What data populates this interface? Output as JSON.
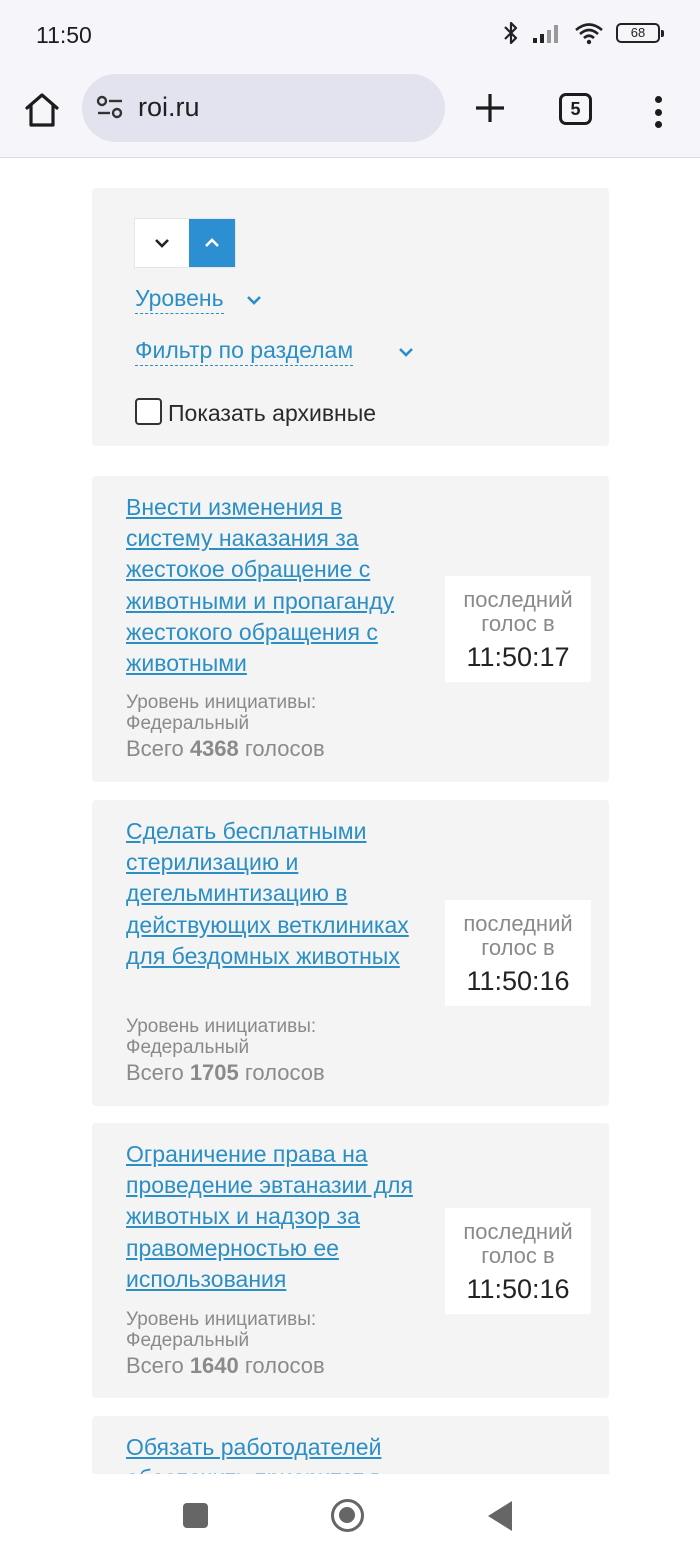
{
  "status_bar": {
    "time": "11:50",
    "battery": "68"
  },
  "browser": {
    "url": "roi.ru",
    "tab_count": "5"
  },
  "filters": {
    "level_label": "Уровень",
    "sections_label": "Фильтр по разделам",
    "archive_label": "Показать архивные"
  },
  "vote_caption": "последний голос в",
  "level_caption": "Уровень инициативы:",
  "total_prefix": "Всего",
  "total_suffix": "голосов",
  "cards": [
    {
      "title": "Внести изменения в систему наказания за жестокое обращение с животными и пропаганду жестокого обращения с животными",
      "level": "Федеральный",
      "votes": "4368",
      "last_vote": "11:50:17"
    },
    {
      "title": "Сделать бесплатными стерилизацию и дегельминтизацию в действующих ветклиниках для бездомных животных",
      "level": "Федеральный",
      "votes": "1705",
      "last_vote": "11:50:16"
    },
    {
      "title": "Ограничение права на проведение эвтаназии для животных и надзор за правомерностью ее использования",
      "level": "Федеральный",
      "votes": "1640",
      "last_vote": "11:50:16"
    },
    {
      "title": "Обязать работодателей обеспечить приоритет в"
    }
  ]
}
